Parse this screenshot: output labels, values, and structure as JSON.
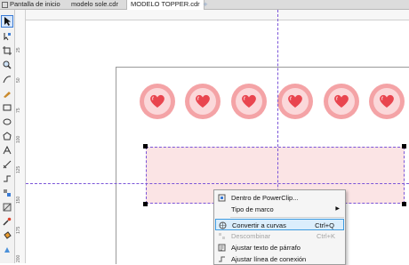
{
  "tabs": {
    "home": "Pantalla de inicio",
    "file1": "modelo sole.cdr",
    "file2": "MODELO TOPPER.cdr",
    "add": "+"
  },
  "context_menu": {
    "items": [
      {
        "label": "Dentro de PowerClip...",
        "shortcut": "",
        "disabled": false
      },
      {
        "label": "Tipo de marco",
        "shortcut": "",
        "disabled": false,
        "submenu": true
      },
      {
        "label": "Convertir a curvas",
        "shortcut": "Ctrl+Q",
        "disabled": false,
        "highlighted": true
      },
      {
        "label": "Descombinar",
        "shortcut": "Ctrl+K",
        "disabled": true
      },
      {
        "label": "Ajustar texto de párrafo",
        "shortcut": "",
        "disabled": false
      },
      {
        "label": "Ajustar línea de conexión",
        "shortcut": "",
        "disabled": false
      }
    ]
  },
  "ruler_labels": [
    "25",
    "50",
    "75",
    "100",
    "125",
    "150",
    "175",
    "200"
  ],
  "colors": {
    "heart_outer": "#f4a3a6",
    "heart_inner": "#fbd8da",
    "heart": "#e9454f",
    "rect_fill": "#fbe4e5",
    "guide": "#7b55d8",
    "highlight": "#3d9be0"
  },
  "heart_count": 6
}
